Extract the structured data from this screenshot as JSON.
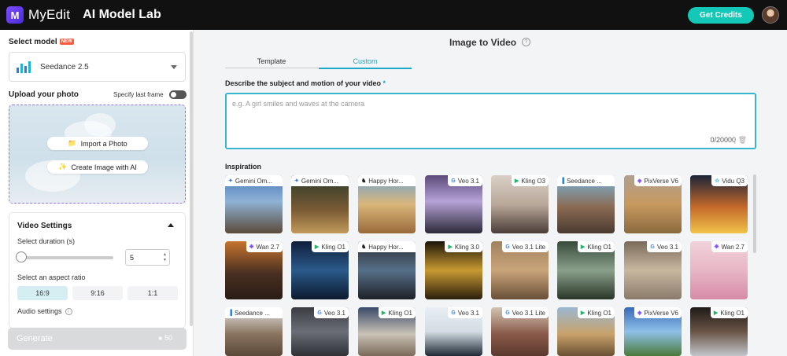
{
  "topbar": {
    "brand": "MyEdit",
    "app_title": "AI Model Lab",
    "credits_label": "Get Credits"
  },
  "left": {
    "select_model_label": "Select model",
    "new_badge": "NEW",
    "model_name": "Seedance 2.5",
    "upload_label": "Upload your photo",
    "specify_last_frame": "Specify last frame",
    "import_photo": "Import a Photo",
    "create_image": "Create Image with AI",
    "video_settings": "Video Settings",
    "duration_label": "Select duration (s)",
    "duration_value": "5",
    "aspect_label": "Select an aspect ratio",
    "aspect_options": [
      "16:9",
      "9:16",
      "1:1"
    ],
    "audio_label": "Audio settings",
    "generate": "Generate",
    "generate_cost": "50"
  },
  "main": {
    "title": "Image to Video",
    "tabs": [
      "Template",
      "Custom"
    ],
    "active_tab": "Custom",
    "prompt_label": "Describe the subject and motion of your video",
    "prompt_placeholder": "e.g. A girl smiles and waves at the camera",
    "prompt_counter": "0/20000",
    "inspiration_label": "Inspiration",
    "cards": [
      {
        "label": "Gemini Om...",
        "icon": "gemini-icon"
      },
      {
        "label": "Gemini Om...",
        "icon": "gemini-icon"
      },
      {
        "label": "Happy Hor...",
        "icon": "happy-horse-icon"
      },
      {
        "label": "Veo 3.1",
        "icon": "google-icon"
      },
      {
        "label": "Kling O3",
        "icon": "kling-icon"
      },
      {
        "label": "Seedance ...",
        "icon": "seedance-icon"
      },
      {
        "label": "PixVerse V6",
        "icon": "pixverse-icon"
      },
      {
        "label": "Vidu Q3",
        "icon": "vidu-icon"
      },
      {
        "label": "Wan 2.7",
        "icon": "wan-icon"
      },
      {
        "label": "Kling O1",
        "icon": "kling-icon"
      },
      {
        "label": "Happy Hor...",
        "icon": "happy-horse-icon"
      },
      {
        "label": "Kling 3.0",
        "icon": "kling-icon"
      },
      {
        "label": "Veo 3.1 Lite",
        "icon": "google-icon"
      },
      {
        "label": "Kling O1",
        "icon": "kling-icon"
      },
      {
        "label": "Veo 3.1",
        "icon": "google-icon"
      },
      {
        "label": "Wan 2.7",
        "icon": "wan-icon"
      },
      {
        "label": "Seedance ...",
        "icon": "seedance-icon"
      },
      {
        "label": "Veo 3.1",
        "icon": "google-icon"
      },
      {
        "label": "Kling O1",
        "icon": "kling-icon"
      },
      {
        "label": "Veo 3.1",
        "icon": "google-icon"
      },
      {
        "label": "Veo 3.1 Lite",
        "icon": "google-icon"
      },
      {
        "label": "Kling O1",
        "icon": "kling-icon"
      },
      {
        "label": "PixVerse V6",
        "icon": "pixverse-icon"
      },
      {
        "label": "Kling O1",
        "icon": "kling-icon"
      }
    ]
  },
  "colors": {
    "accent": "#1ba8c9",
    "credits_button": "#14c8b8",
    "upload_border": "#9b73d8"
  }
}
